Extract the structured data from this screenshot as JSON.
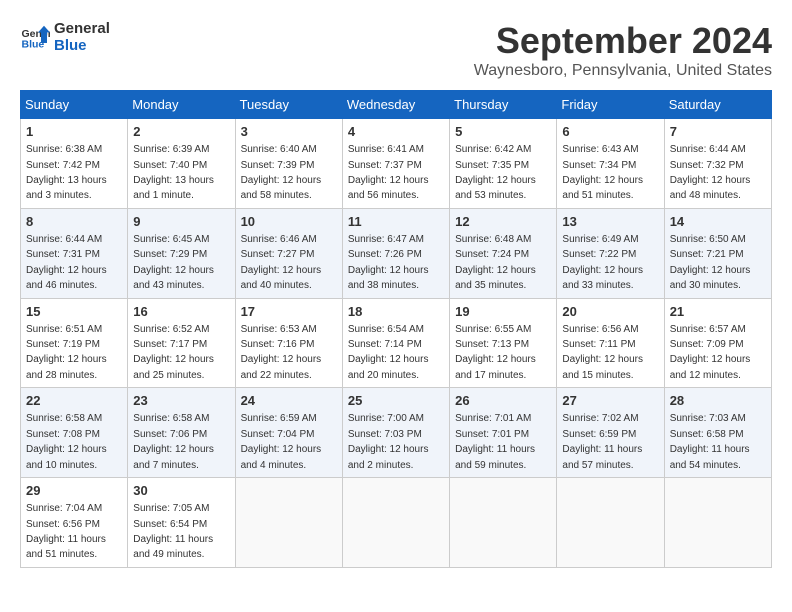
{
  "logo": {
    "line1": "General",
    "line2": "Blue"
  },
  "title": "September 2024",
  "location": "Waynesboro, Pennsylvania, United States",
  "headers": [
    "Sunday",
    "Monday",
    "Tuesday",
    "Wednesday",
    "Thursday",
    "Friday",
    "Saturday"
  ],
  "weeks": [
    [
      {
        "day": "1",
        "sunrise": "6:38 AM",
        "sunset": "7:42 PM",
        "daylight": "13 hours and 3 minutes."
      },
      {
        "day": "2",
        "sunrise": "6:39 AM",
        "sunset": "7:40 PM",
        "daylight": "13 hours and 1 minute."
      },
      {
        "day": "3",
        "sunrise": "6:40 AM",
        "sunset": "7:39 PM",
        "daylight": "12 hours and 58 minutes."
      },
      {
        "day": "4",
        "sunrise": "6:41 AM",
        "sunset": "7:37 PM",
        "daylight": "12 hours and 56 minutes."
      },
      {
        "day": "5",
        "sunrise": "6:42 AM",
        "sunset": "7:35 PM",
        "daylight": "12 hours and 53 minutes."
      },
      {
        "day": "6",
        "sunrise": "6:43 AM",
        "sunset": "7:34 PM",
        "daylight": "12 hours and 51 minutes."
      },
      {
        "day": "7",
        "sunrise": "6:44 AM",
        "sunset": "7:32 PM",
        "daylight": "12 hours and 48 minutes."
      }
    ],
    [
      {
        "day": "8",
        "sunrise": "6:44 AM",
        "sunset": "7:31 PM",
        "daylight": "12 hours and 46 minutes."
      },
      {
        "day": "9",
        "sunrise": "6:45 AM",
        "sunset": "7:29 PM",
        "daylight": "12 hours and 43 minutes."
      },
      {
        "day": "10",
        "sunrise": "6:46 AM",
        "sunset": "7:27 PM",
        "daylight": "12 hours and 40 minutes."
      },
      {
        "day": "11",
        "sunrise": "6:47 AM",
        "sunset": "7:26 PM",
        "daylight": "12 hours and 38 minutes."
      },
      {
        "day": "12",
        "sunrise": "6:48 AM",
        "sunset": "7:24 PM",
        "daylight": "12 hours and 35 minutes."
      },
      {
        "day": "13",
        "sunrise": "6:49 AM",
        "sunset": "7:22 PM",
        "daylight": "12 hours and 33 minutes."
      },
      {
        "day": "14",
        "sunrise": "6:50 AM",
        "sunset": "7:21 PM",
        "daylight": "12 hours and 30 minutes."
      }
    ],
    [
      {
        "day": "15",
        "sunrise": "6:51 AM",
        "sunset": "7:19 PM",
        "daylight": "12 hours and 28 minutes."
      },
      {
        "day": "16",
        "sunrise": "6:52 AM",
        "sunset": "7:17 PM",
        "daylight": "12 hours and 25 minutes."
      },
      {
        "day": "17",
        "sunrise": "6:53 AM",
        "sunset": "7:16 PM",
        "daylight": "12 hours and 22 minutes."
      },
      {
        "day": "18",
        "sunrise": "6:54 AM",
        "sunset": "7:14 PM",
        "daylight": "12 hours and 20 minutes."
      },
      {
        "day": "19",
        "sunrise": "6:55 AM",
        "sunset": "7:13 PM",
        "daylight": "12 hours and 17 minutes."
      },
      {
        "day": "20",
        "sunrise": "6:56 AM",
        "sunset": "7:11 PM",
        "daylight": "12 hours and 15 minutes."
      },
      {
        "day": "21",
        "sunrise": "6:57 AM",
        "sunset": "7:09 PM",
        "daylight": "12 hours and 12 minutes."
      }
    ],
    [
      {
        "day": "22",
        "sunrise": "6:58 AM",
        "sunset": "7:08 PM",
        "daylight": "12 hours and 10 minutes."
      },
      {
        "day": "23",
        "sunrise": "6:58 AM",
        "sunset": "7:06 PM",
        "daylight": "12 hours and 7 minutes."
      },
      {
        "day": "24",
        "sunrise": "6:59 AM",
        "sunset": "7:04 PM",
        "daylight": "12 hours and 4 minutes."
      },
      {
        "day": "25",
        "sunrise": "7:00 AM",
        "sunset": "7:03 PM",
        "daylight": "12 hours and 2 minutes."
      },
      {
        "day": "26",
        "sunrise": "7:01 AM",
        "sunset": "7:01 PM",
        "daylight": "11 hours and 59 minutes."
      },
      {
        "day": "27",
        "sunrise": "7:02 AM",
        "sunset": "6:59 PM",
        "daylight": "11 hours and 57 minutes."
      },
      {
        "day": "28",
        "sunrise": "7:03 AM",
        "sunset": "6:58 PM",
        "daylight": "11 hours and 54 minutes."
      }
    ],
    [
      {
        "day": "29",
        "sunrise": "7:04 AM",
        "sunset": "6:56 PM",
        "daylight": "11 hours and 51 minutes."
      },
      {
        "day": "30",
        "sunrise": "7:05 AM",
        "sunset": "6:54 PM",
        "daylight": "11 hours and 49 minutes."
      },
      null,
      null,
      null,
      null,
      null
    ]
  ]
}
